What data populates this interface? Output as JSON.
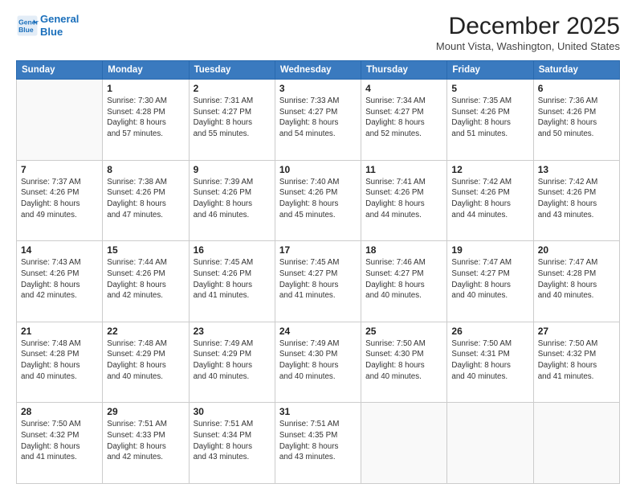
{
  "header": {
    "logo_line1": "General",
    "logo_line2": "Blue",
    "month": "December 2025",
    "location": "Mount Vista, Washington, United States"
  },
  "days": [
    "Sunday",
    "Monday",
    "Tuesday",
    "Wednesday",
    "Thursday",
    "Friday",
    "Saturday"
  ],
  "weeks": [
    [
      {
        "date": "",
        "info": ""
      },
      {
        "date": "1",
        "info": "Sunrise: 7:30 AM\nSunset: 4:28 PM\nDaylight: 8 hours\nand 57 minutes."
      },
      {
        "date": "2",
        "info": "Sunrise: 7:31 AM\nSunset: 4:27 PM\nDaylight: 8 hours\nand 55 minutes."
      },
      {
        "date": "3",
        "info": "Sunrise: 7:33 AM\nSunset: 4:27 PM\nDaylight: 8 hours\nand 54 minutes."
      },
      {
        "date": "4",
        "info": "Sunrise: 7:34 AM\nSunset: 4:27 PM\nDaylight: 8 hours\nand 52 minutes."
      },
      {
        "date": "5",
        "info": "Sunrise: 7:35 AM\nSunset: 4:26 PM\nDaylight: 8 hours\nand 51 minutes."
      },
      {
        "date": "6",
        "info": "Sunrise: 7:36 AM\nSunset: 4:26 PM\nDaylight: 8 hours\nand 50 minutes."
      }
    ],
    [
      {
        "date": "7",
        "info": "Sunrise: 7:37 AM\nSunset: 4:26 PM\nDaylight: 8 hours\nand 49 minutes."
      },
      {
        "date": "8",
        "info": "Sunrise: 7:38 AM\nSunset: 4:26 PM\nDaylight: 8 hours\nand 47 minutes."
      },
      {
        "date": "9",
        "info": "Sunrise: 7:39 AM\nSunset: 4:26 PM\nDaylight: 8 hours\nand 46 minutes."
      },
      {
        "date": "10",
        "info": "Sunrise: 7:40 AM\nSunset: 4:26 PM\nDaylight: 8 hours\nand 45 minutes."
      },
      {
        "date": "11",
        "info": "Sunrise: 7:41 AM\nSunset: 4:26 PM\nDaylight: 8 hours\nand 44 minutes."
      },
      {
        "date": "12",
        "info": "Sunrise: 7:42 AM\nSunset: 4:26 PM\nDaylight: 8 hours\nand 44 minutes."
      },
      {
        "date": "13",
        "info": "Sunrise: 7:42 AM\nSunset: 4:26 PM\nDaylight: 8 hours\nand 43 minutes."
      }
    ],
    [
      {
        "date": "14",
        "info": "Sunrise: 7:43 AM\nSunset: 4:26 PM\nDaylight: 8 hours\nand 42 minutes."
      },
      {
        "date": "15",
        "info": "Sunrise: 7:44 AM\nSunset: 4:26 PM\nDaylight: 8 hours\nand 42 minutes."
      },
      {
        "date": "16",
        "info": "Sunrise: 7:45 AM\nSunset: 4:26 PM\nDaylight: 8 hours\nand 41 minutes."
      },
      {
        "date": "17",
        "info": "Sunrise: 7:45 AM\nSunset: 4:27 PM\nDaylight: 8 hours\nand 41 minutes."
      },
      {
        "date": "18",
        "info": "Sunrise: 7:46 AM\nSunset: 4:27 PM\nDaylight: 8 hours\nand 40 minutes."
      },
      {
        "date": "19",
        "info": "Sunrise: 7:47 AM\nSunset: 4:27 PM\nDaylight: 8 hours\nand 40 minutes."
      },
      {
        "date": "20",
        "info": "Sunrise: 7:47 AM\nSunset: 4:28 PM\nDaylight: 8 hours\nand 40 minutes."
      }
    ],
    [
      {
        "date": "21",
        "info": "Sunrise: 7:48 AM\nSunset: 4:28 PM\nDaylight: 8 hours\nand 40 minutes."
      },
      {
        "date": "22",
        "info": "Sunrise: 7:48 AM\nSunset: 4:29 PM\nDaylight: 8 hours\nand 40 minutes."
      },
      {
        "date": "23",
        "info": "Sunrise: 7:49 AM\nSunset: 4:29 PM\nDaylight: 8 hours\nand 40 minutes."
      },
      {
        "date": "24",
        "info": "Sunrise: 7:49 AM\nSunset: 4:30 PM\nDaylight: 8 hours\nand 40 minutes."
      },
      {
        "date": "25",
        "info": "Sunrise: 7:50 AM\nSunset: 4:30 PM\nDaylight: 8 hours\nand 40 minutes."
      },
      {
        "date": "26",
        "info": "Sunrise: 7:50 AM\nSunset: 4:31 PM\nDaylight: 8 hours\nand 40 minutes."
      },
      {
        "date": "27",
        "info": "Sunrise: 7:50 AM\nSunset: 4:32 PM\nDaylight: 8 hours\nand 41 minutes."
      }
    ],
    [
      {
        "date": "28",
        "info": "Sunrise: 7:50 AM\nSunset: 4:32 PM\nDaylight: 8 hours\nand 41 minutes."
      },
      {
        "date": "29",
        "info": "Sunrise: 7:51 AM\nSunset: 4:33 PM\nDaylight: 8 hours\nand 42 minutes."
      },
      {
        "date": "30",
        "info": "Sunrise: 7:51 AM\nSunset: 4:34 PM\nDaylight: 8 hours\nand 43 minutes."
      },
      {
        "date": "31",
        "info": "Sunrise: 7:51 AM\nSunset: 4:35 PM\nDaylight: 8 hours\nand 43 minutes."
      },
      {
        "date": "",
        "info": ""
      },
      {
        "date": "",
        "info": ""
      },
      {
        "date": "",
        "info": ""
      }
    ]
  ]
}
